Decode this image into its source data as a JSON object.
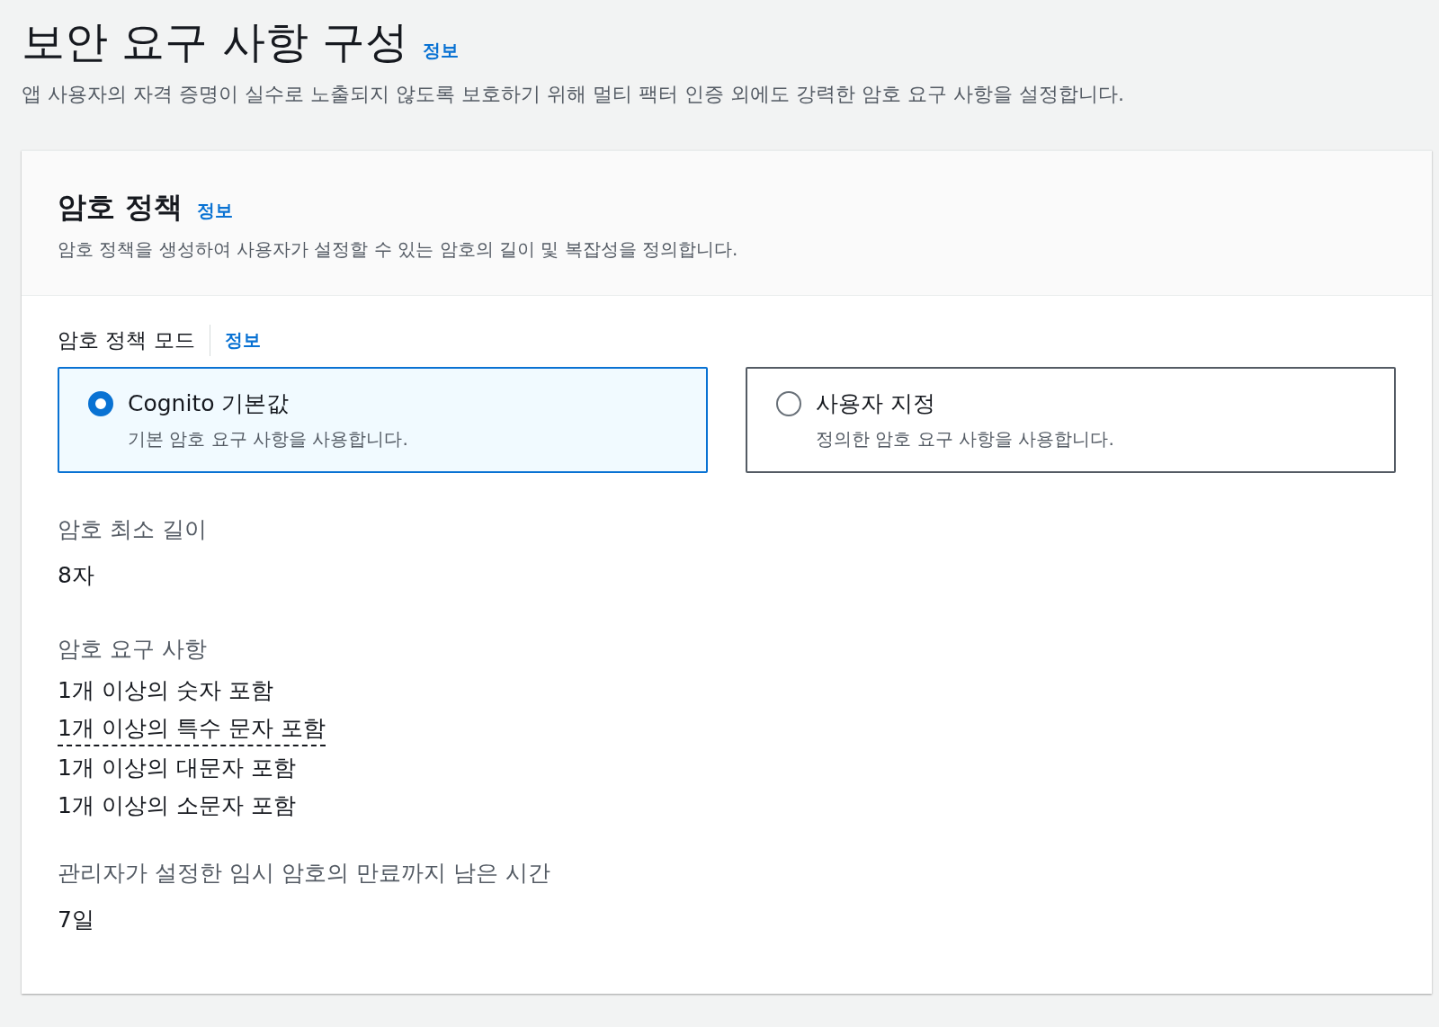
{
  "header": {
    "title": "보안 요구 사항 구성",
    "info": "정보",
    "description": "앱 사용자의 자격 증명이 실수로 노출되지 않도록 보호하기 위해 멀티 팩터 인증 외에도 강력한 암호 요구 사항을 설정합니다."
  },
  "panel": {
    "title": "암호 정책",
    "info": "정보",
    "description": "암호 정책을 생성하여 사용자가 설정할 수 있는 암호의 길이 및 복잡성을 정의합니다.",
    "mode": {
      "label": "암호 정책 모드",
      "info": "정보",
      "options": [
        {
          "label": "Cognito 기본값",
          "description": "기본 암호 요구 사항을 사용합니다.",
          "selected": true
        },
        {
          "label": "사용자 지정",
          "description": "정의한 암호 요구 사항을 사용합니다.",
          "selected": false
        }
      ]
    },
    "min_length": {
      "label": "암호 최소 길이",
      "value": "8자"
    },
    "requirements": {
      "label": "암호 요구 사항",
      "items": [
        {
          "text": "1개 이상의 숫자 포함",
          "kind": "plain"
        },
        {
          "text": "1개 이상의 특수 문자 포함",
          "kind": "tooltip"
        },
        {
          "text": "1개 이상의 대문자 포함",
          "kind": "plain"
        },
        {
          "text": "1개 이상의 소문자 포함",
          "kind": "plain"
        }
      ]
    },
    "temp_expiry": {
      "label": "관리자가 설정한 임시 암호의 만료까지 남은 시간",
      "value": "7일"
    }
  }
}
